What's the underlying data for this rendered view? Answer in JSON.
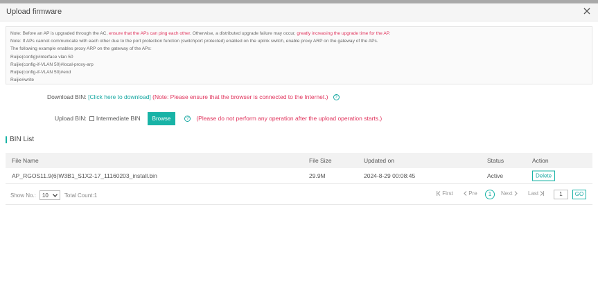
{
  "dialog": {
    "title": "Upload firmware"
  },
  "note": {
    "line1_a": "Note:  Before an AP is upgraded through the AC, ",
    "line1_b": "ensure that the APs can ping each other",
    "line1_c": ". Otherwise, a distributed upgrade failure may occur, ",
    "line1_d": "greatly increasing the upgrade time for the AP",
    "line1_e": ".",
    "line2": "Note: If APs cannot communicate with each other due to the port protection function (switchport protected) enabled on the uplink switch, enable proxy ARP on the gateway of the APs.",
    "line3": "The following example enables proxy ARP on the gateway of the APs:",
    "line4": "Ruijie(config)#interface vlan 50",
    "line5": "Ruijie(config-if-VLAN 50)#local-proxy-arp",
    "line6": "Ruijie(config-if-VLAN 50)#end",
    "line7": "Ruijie#write"
  },
  "download": {
    "label": "Download BIN:",
    "link": "[Click here to download]",
    "warning": "(Note: Please ensure that the browser is connected to the Internet.)",
    "help": "?"
  },
  "upload": {
    "label": "Upload BIN:",
    "checkbox_label": "Intermediate BIN",
    "browse": "Browse",
    "help": "?",
    "warning": "(Please do not perform any operation after the upload operation starts.)"
  },
  "bin_list": {
    "title": "BIN List",
    "columns": [
      "File Name",
      "File Size",
      "Updated on",
      "Status",
      "Action"
    ],
    "rows": [
      {
        "file_name": "AP_RGOS11.9(6)W3B1_S1X2-17_11160203_install.bin",
        "file_size": "29.9M",
        "updated_on": "2024-8-29 00:08:45",
        "status": "Active",
        "action": "Delete"
      }
    ]
  },
  "pagination": {
    "show_no_label": "Show No.:",
    "page_size": "10",
    "total": "Total Count:1",
    "first": "First",
    "prev": "Pre",
    "current_page": "1",
    "next": "Next",
    "last": "Last",
    "page_input": "1",
    "go": "GO"
  },
  "colors": {
    "accent": "#18b3a6",
    "warning": "#e0325b"
  },
  "icons": [
    "close-icon",
    "help-icon",
    "chevron-down-icon",
    "first-page-icon",
    "prev-page-icon",
    "next-page-icon",
    "last-page-icon"
  ]
}
